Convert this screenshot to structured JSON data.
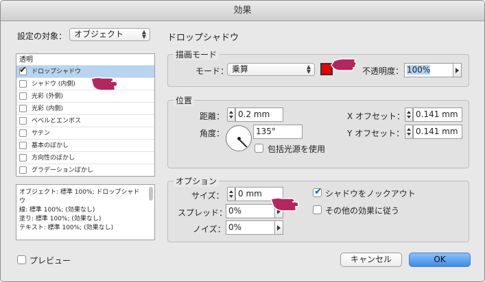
{
  "window": {
    "title": "効果"
  },
  "left": {
    "target_label": "設定の対象：",
    "target_value": "オブジェクト",
    "list_header": "透明",
    "items": [
      {
        "label": "ドロップシャドウ",
        "checked": true,
        "selected": true
      },
      {
        "label": "シャドウ (内側)",
        "checked": false,
        "selected": false
      },
      {
        "label": "光彩 (外側)",
        "checked": false,
        "selected": false
      },
      {
        "label": "光彩 (内側)",
        "checked": false,
        "selected": false
      },
      {
        "label": "ベベルとエンボス",
        "checked": false,
        "selected": false
      },
      {
        "label": "サテン",
        "checked": false,
        "selected": false
      },
      {
        "label": "基本のぼかし",
        "checked": false,
        "selected": false
      },
      {
        "label": "方向性のぼかし",
        "checked": false,
        "selected": false
      },
      {
        "label": "グラデーションぼかし",
        "checked": false,
        "selected": false
      }
    ],
    "summary": [
      "オブジェクト: 標準 100%; ドロップシャドウ",
      "線: 標準 100%; (効果なし)",
      "塗り: 標準 100%; (効果なし)",
      "テキスト: 標準 100%; (効果なし)"
    ]
  },
  "panel": {
    "title": "ドロップシャドウ",
    "blend": {
      "title": "描画モード",
      "mode_label": "モード：",
      "mode_value": "乗算",
      "color": "#e80000",
      "opacity_label": "不透明度：",
      "opacity_value": "100%"
    },
    "position": {
      "title": "位置",
      "distance_label": "距離：",
      "distance_value": "0.2 mm",
      "angle_label": "角度：",
      "angle_value": "135°",
      "global_light_label": "包括光源を使用",
      "x_offset_label": "X オフセット：",
      "x_offset_value": "0.141 mm",
      "y_offset_label": "Y オフセット：",
      "y_offset_value": "0.141 mm"
    },
    "options": {
      "title": "オプション",
      "size_label": "サイズ：",
      "size_value": "0 mm",
      "spread_label": "スプレッド：",
      "spread_value": "0%",
      "noise_label": "ノイズ：",
      "noise_value": "0%",
      "knockout_label": "シャドウをノックアウト",
      "honor_label": "その他の効果に従う"
    }
  },
  "footer": {
    "preview_label": "プレビュー",
    "cancel_label": "キャンセル",
    "ok_label": "OK"
  }
}
